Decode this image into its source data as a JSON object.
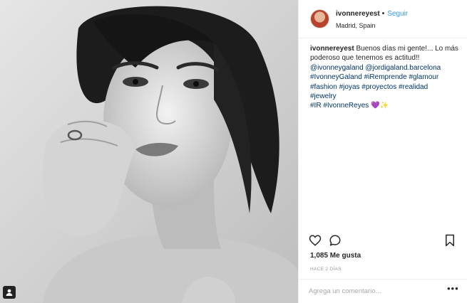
{
  "post": {
    "username": "ivonnereyest",
    "separator": "•",
    "follow_label": "Seguir",
    "location": "Madrid, Spain",
    "caption": {
      "username": "ivonnereyest",
      "text": "Buenos días mi gente!... Lo más poderoso que tenemos es actitud!!",
      "mentions": [
        "@ivonneygaland",
        "@jordigaland.barcelona"
      ],
      "hashtags_line1": [
        "#IvonneyGaland",
        "#iRemprende",
        "#glamour"
      ],
      "hashtags_line2": [
        "#fashion",
        "#joyas",
        "#proyectos",
        "#realidad"
      ],
      "hashtags_line3": [
        "#jewelry"
      ],
      "hashtags_line4": [
        "#IR",
        "#IvonneReyes"
      ],
      "emoji": "💜✨"
    },
    "likes": "1,085 Me gusta",
    "time_ago": "HACE 2 DÍAS",
    "comment_placeholder": "Agrega un comentario...",
    "more_label": "•••"
  },
  "icons": {
    "like": "heart-icon",
    "comment": "comment-icon",
    "save": "bookmark-icon",
    "tag": "user-tag-icon"
  }
}
